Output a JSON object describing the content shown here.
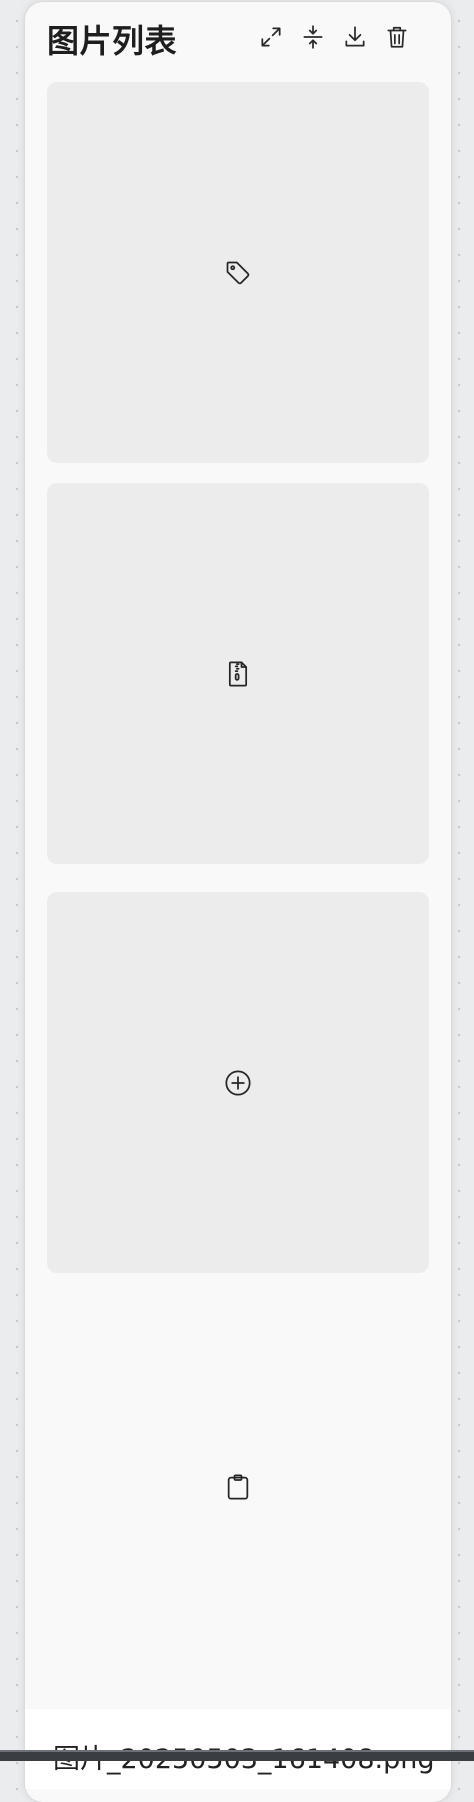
{
  "header": {
    "title": "图片列表",
    "tools": [
      {
        "name": "expand-button",
        "icon": "expand-icon"
      },
      {
        "name": "collapse-button",
        "icon": "collapse-vertical-icon"
      },
      {
        "name": "download-button",
        "icon": "download-icon"
      },
      {
        "name": "delete-button",
        "icon": "trash-icon"
      }
    ]
  },
  "cards": [
    {
      "icon": "tag-icon",
      "tone": "#ececec"
    },
    {
      "icon": "zip-file-icon",
      "tone": "#ececec"
    },
    {
      "icon": "add-circle-icon",
      "tone": "#ececec"
    },
    {
      "icon": "clipboard-icon",
      "tone": "#f9f9f9"
    }
  ],
  "file": {
    "name": "图片_20250503_161408.png"
  },
  "colors": {
    "background": "#ebecee",
    "panel": "#f9f9f9",
    "card": "#ececec",
    "text": "#1e1e1e"
  }
}
